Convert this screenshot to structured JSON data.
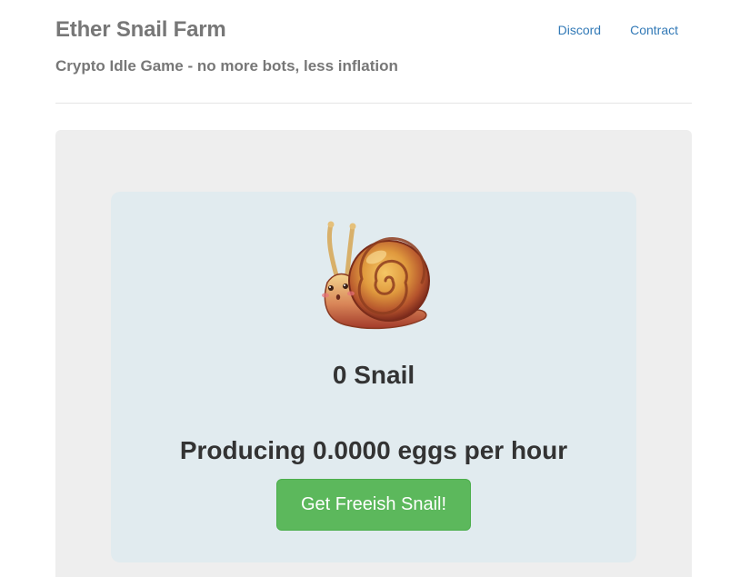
{
  "header": {
    "title": "Ether Snail Farm",
    "subtitle": "Crypto Idle Game - no more bots, less inflation",
    "nav": [
      {
        "label": "Discord"
      },
      {
        "label": "Contract"
      }
    ]
  },
  "main": {
    "snail_image": "snail-icon",
    "snail_count_text": "0 Snail",
    "production_text": "Producing 0.0000 eggs per hour",
    "button_label": "Get Freeish Snail!"
  },
  "colors": {
    "button": "#5cb85c",
    "link": "#337ab7",
    "card": "#e1ebef",
    "well": "#eeeeee"
  }
}
